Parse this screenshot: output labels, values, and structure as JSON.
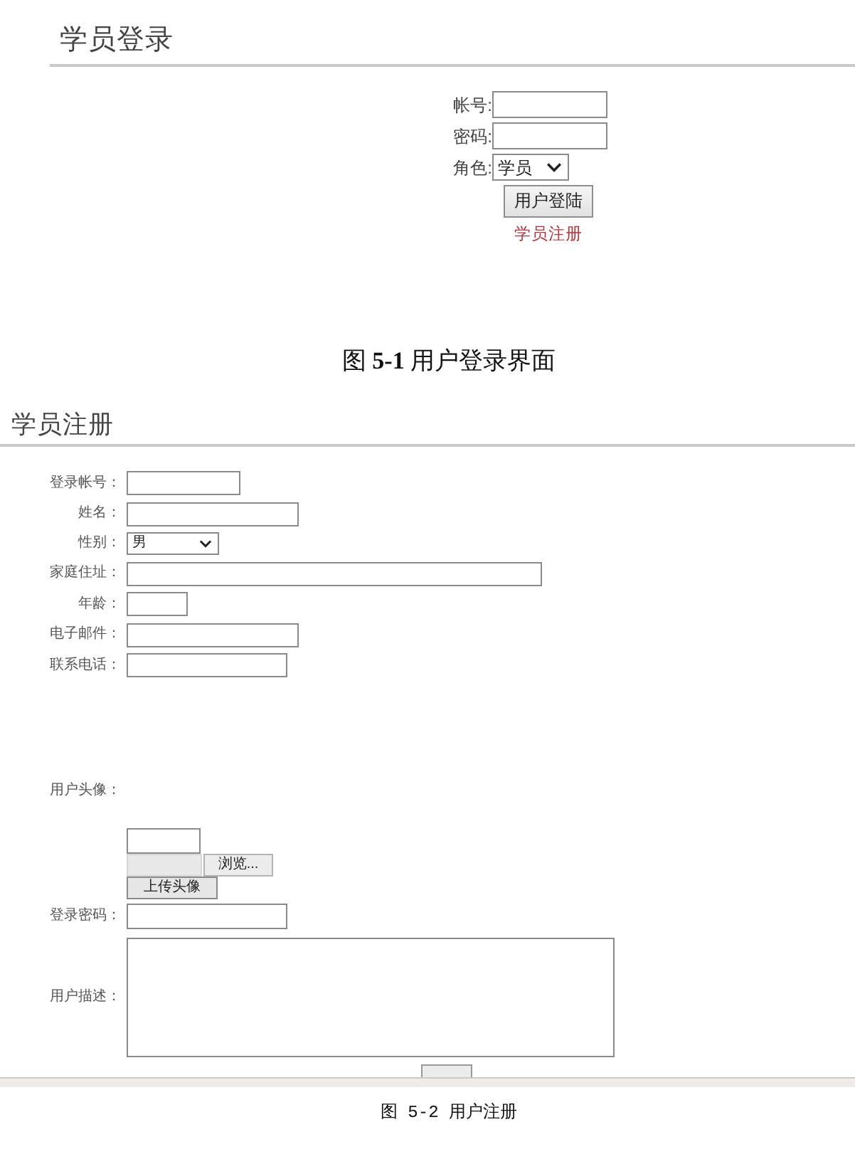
{
  "login_screen": {
    "title": "学员登录",
    "fields": [
      {
        "kind": "text",
        "label": "帐号:"
      },
      {
        "kind": "text",
        "label": "密码:"
      },
      {
        "kind": "select",
        "label": "角色:",
        "value": "学员"
      }
    ],
    "button": "用户登陆",
    "link": "学员注册"
  },
  "caption_1": "图 **5-1** 用户登录界面",
  "register_screen": {
    "title": "学员注册",
    "rows": [
      {
        "kind": "text",
        "label": "登录帐号："
      },
      {
        "kind": "text",
        "label": "姓名："
      },
      {
        "kind": "select",
        "label": "性别：",
        "value": "男"
      },
      {
        "kind": "text",
        "label": "家庭住址："
      },
      {
        "kind": "text",
        "label": "年龄："
      },
      {
        "kind": "text",
        "label": "电子邮件："
      },
      {
        "kind": "text",
        "label": "联系电话："
      },
      {
        "kind": "image",
        "label": "用户头像："
      },
      {
        "kind": "upload",
        "browse_button": "浏览...",
        "upload_button": "上传头像"
      },
      {
        "kind": "text",
        "label": "登录密码："
      },
      {
        "kind": "textarea",
        "label": "用户描述："
      }
    ]
  },
  "caption_2": "图 5-2 用户注册"
}
